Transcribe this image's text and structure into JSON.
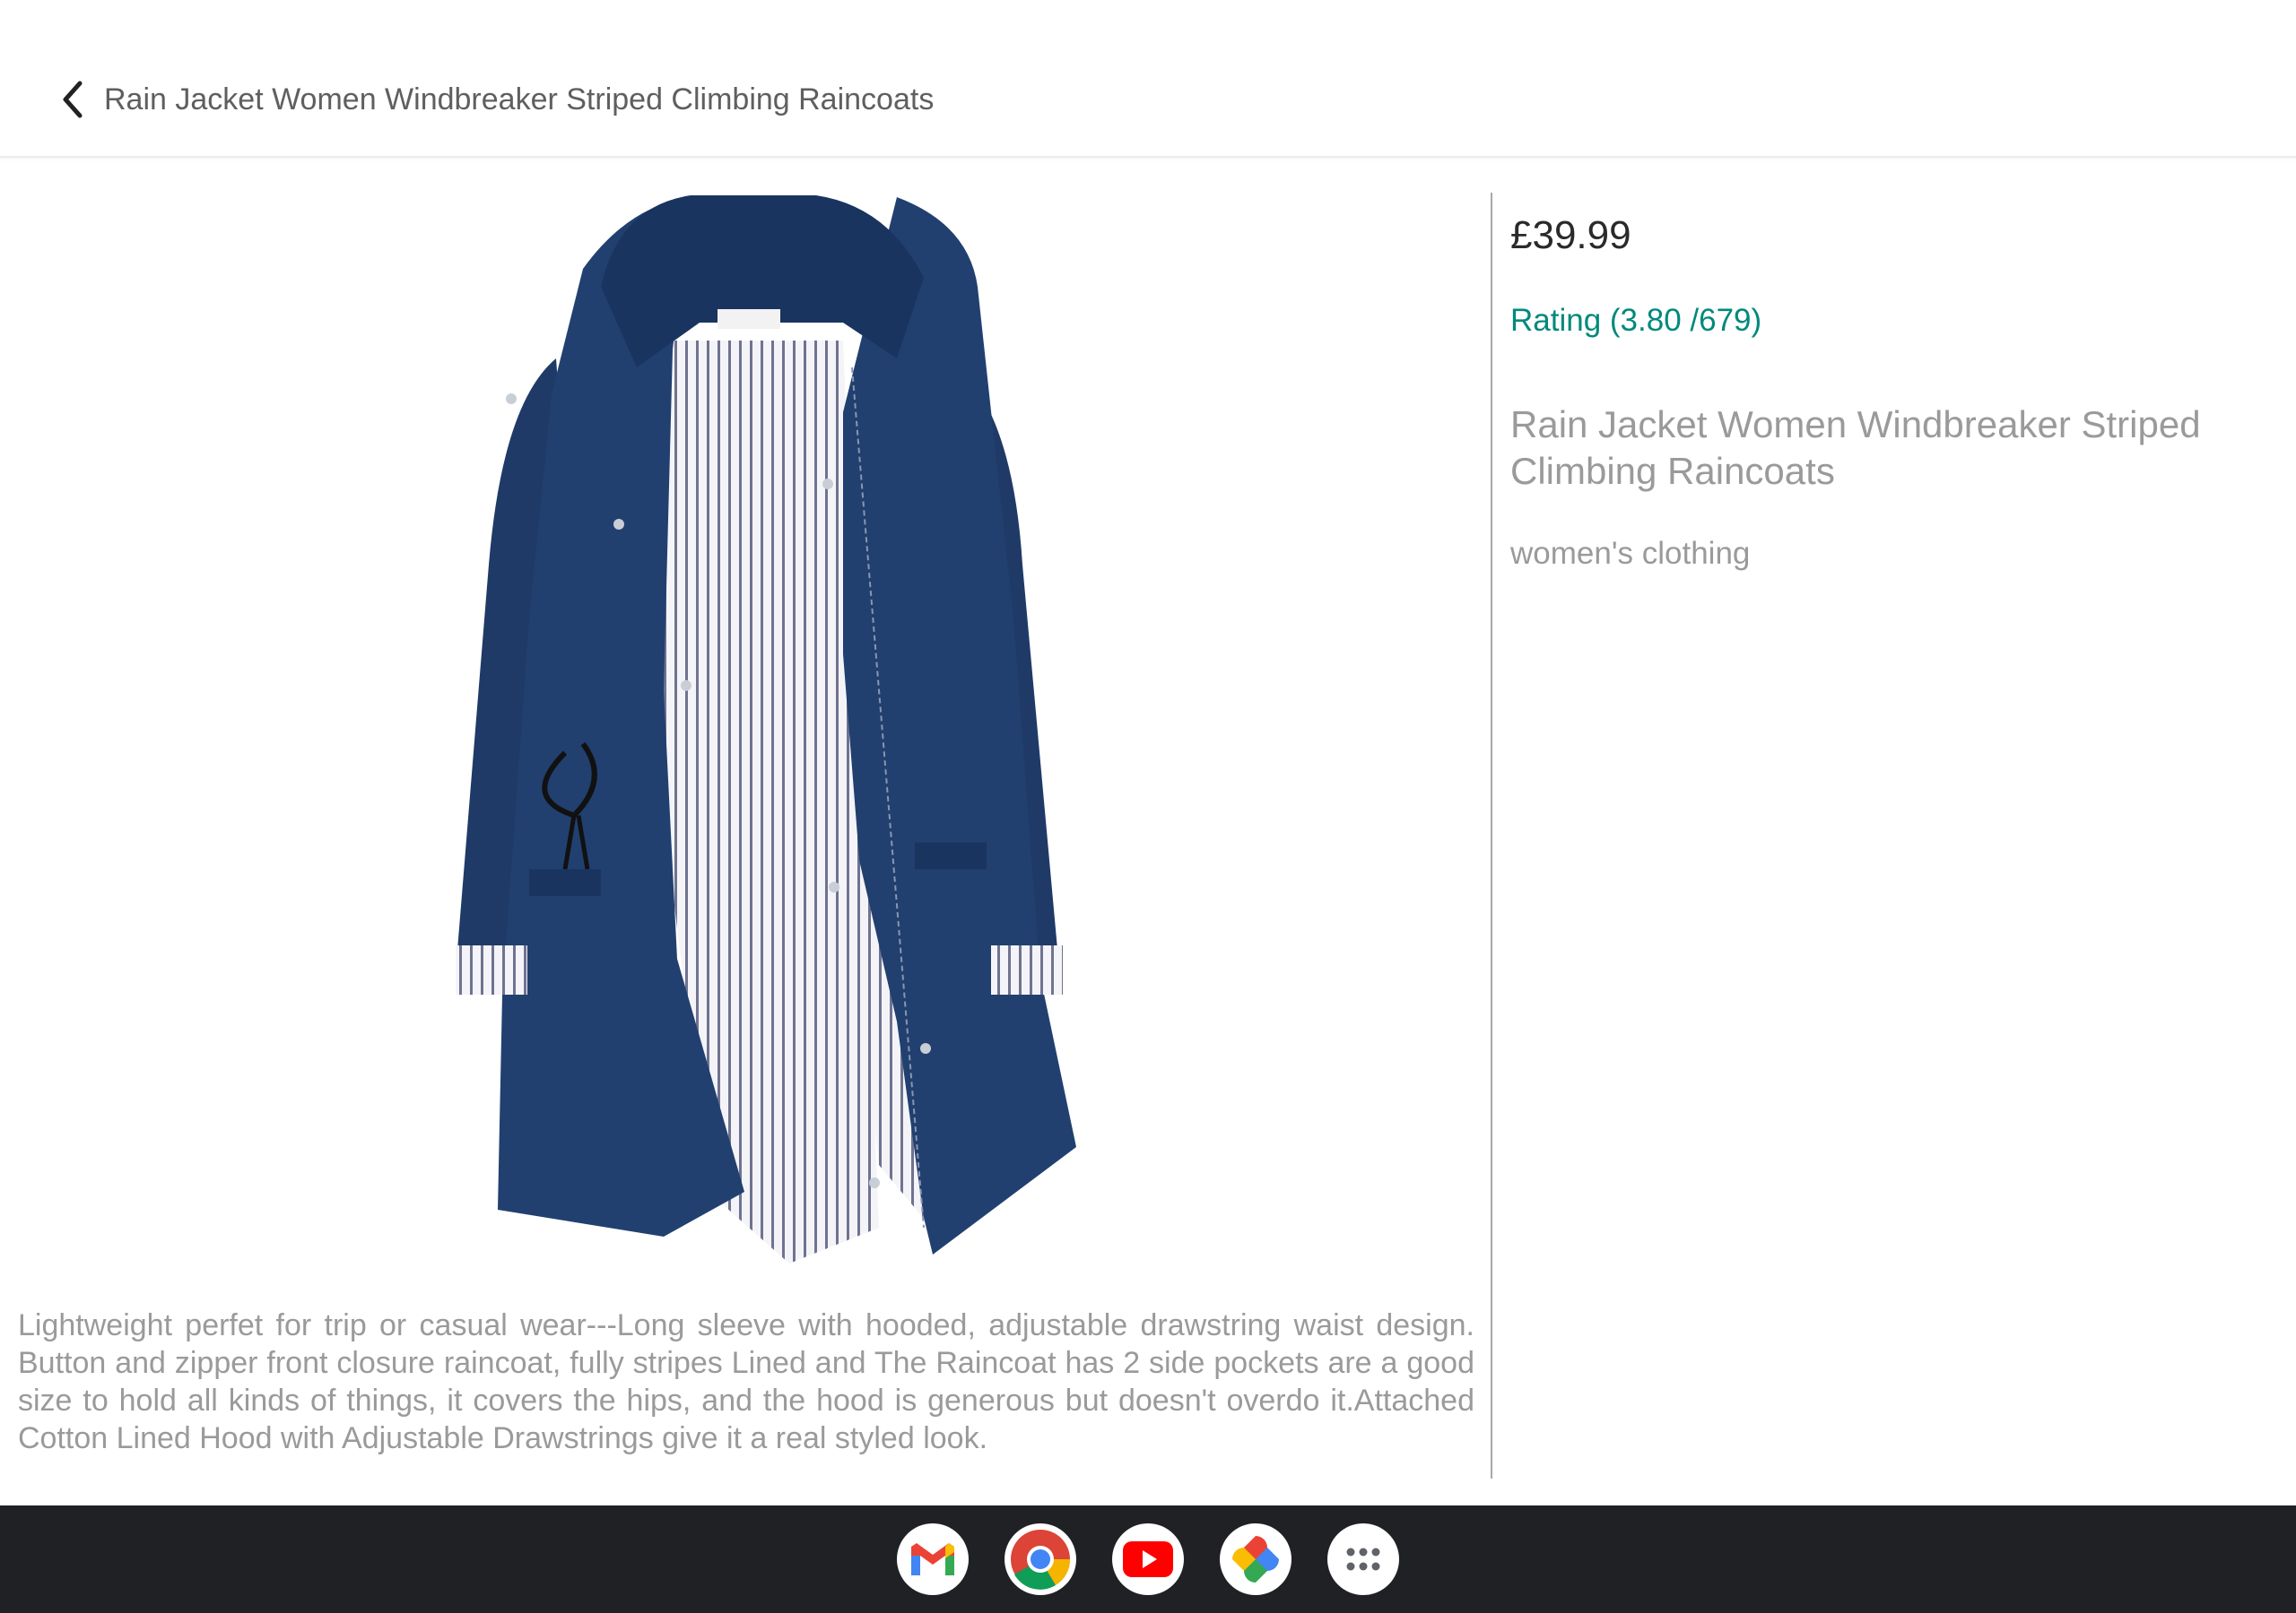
{
  "header": {
    "back_icon": "chevron-left-icon",
    "title": "Rain Jacket Women Windbreaker Striped Climbing Raincoats"
  },
  "product": {
    "image_alt": "Navy blue rain jacket with striped lining",
    "description": "Lightweight perfet for trip or casual wear---Long sleeve with hooded, adjustable drawstring waist design. Button and zipper front closure raincoat, fully stripes Lined and The Raincoat has 2 side pockets are a good size to hold all kinds of things, it covers the hips, and the hood is generous but doesn't overdo it.Attached Cotton Lined Hood with Adjustable Drawstrings give it a real styled look.",
    "price": "£39.99",
    "rating": "Rating (3.80 /679)",
    "title": "Rain Jacket Women Windbreaker Striped Climbing Raincoats",
    "category": "women's clothing"
  },
  "colors": {
    "rating": "#00897b",
    "jacket": "#1f3a66",
    "shelf": "#202124"
  },
  "shelf": {
    "apps": [
      {
        "name": "Gmail",
        "icon": "gmail-icon"
      },
      {
        "name": "Chrome",
        "icon": "chrome-icon"
      },
      {
        "name": "YouTube",
        "icon": "youtube-icon"
      },
      {
        "name": "Photos",
        "icon": "photos-icon"
      },
      {
        "name": "Launcher",
        "icon": "apps-grid-icon"
      }
    ]
  }
}
